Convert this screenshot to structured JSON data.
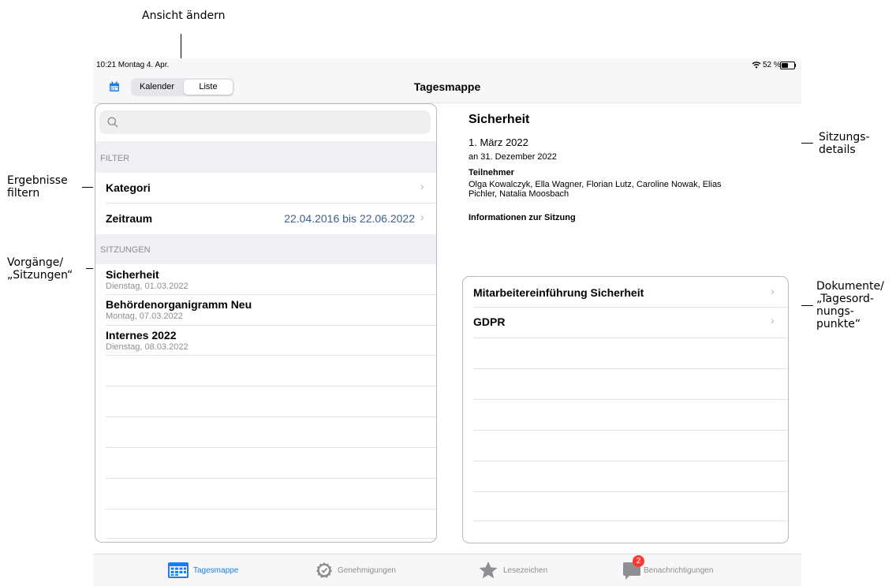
{
  "annotations": {
    "change_view": "Ansicht ändern",
    "filter_results": [
      "Ergebnisse",
      "filtern"
    ],
    "procedures": [
      "Vorgänge/",
      "„Sitzungen“"
    ],
    "session_details": [
      "Sitzungs-",
      "details"
    ],
    "documents": [
      "Dokumente/",
      "„Tagesord-",
      "nungs-",
      "punkte“"
    ]
  },
  "status_bar": {
    "time_date": "10:21  Montag 4. Apr.",
    "battery": "52 %"
  },
  "nav": {
    "title": "Tagesmappe",
    "segments": [
      "Kalender",
      "Liste"
    ],
    "selected_segment": "Liste"
  },
  "sidebar": {
    "filter_header": "FILTER",
    "filters": [
      {
        "label": "Kategori",
        "value": ""
      },
      {
        "label": "Zeitraum",
        "value": "22.04.2016 bis 22.06.2022"
      }
    ],
    "sessions_header": "SITZUNGEN",
    "sessions": [
      {
        "title": "Sicherheit",
        "date": "Dienstag, 01.03.2022"
      },
      {
        "title": "Behördenorganigramm Neu",
        "date": "Montag, 07.03.2022"
      },
      {
        "title": "Internes 2022",
        "date": "Dienstag, 08.03.2022"
      }
    ]
  },
  "detail": {
    "title": "Sicherheit",
    "date": "1. März 2022",
    "until": "an 31. Dezember 2022",
    "participants_label": "Teilnehmer",
    "participants": [
      "Olga Kowalczyk, Ella Wagner, Florian Lutz, Caroline Nowak, Elias",
      "Pichler, Natalia Moosbach"
    ],
    "info_label": "Informationen zur Sitzung",
    "documents": [
      "Mitarbeitereinführung Sicherheit",
      "GDPR"
    ]
  },
  "tabbar": {
    "tabs": [
      "Tagesmappe",
      "Genehmigungen",
      "Lesezeichen",
      "Benachrichtigungen"
    ],
    "active": "Tagesmappe",
    "badge": "2"
  },
  "colors": {
    "accent": "#1a7ef0",
    "badge": "#ff3b30",
    "secondary_text": "#8e8e93",
    "date_value": "#3a5f8f"
  }
}
